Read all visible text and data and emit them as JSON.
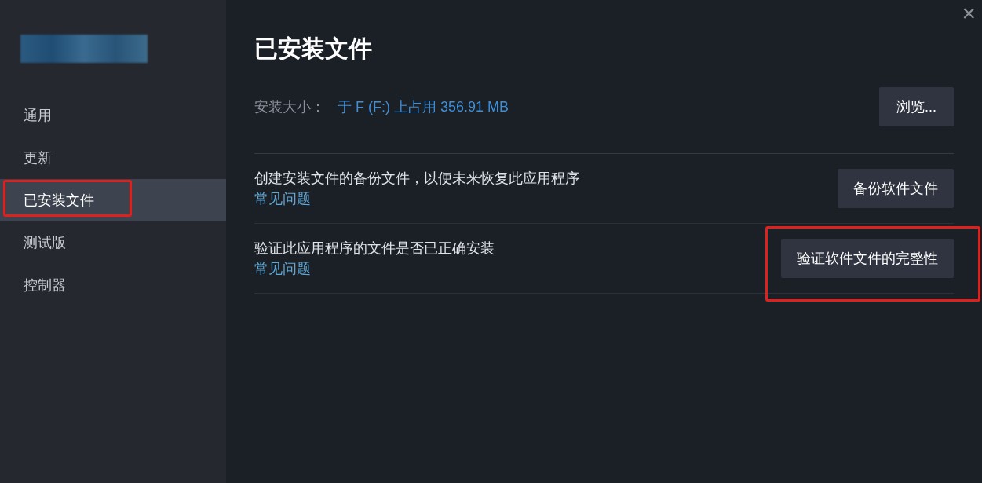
{
  "sidebar": {
    "items": [
      {
        "label": "通用",
        "selected": false,
        "highlighted": false
      },
      {
        "label": "更新",
        "selected": false,
        "highlighted": false
      },
      {
        "label": "已安装文件",
        "selected": true,
        "highlighted": true
      },
      {
        "label": "测试版",
        "selected": false,
        "highlighted": false
      },
      {
        "label": "控制器",
        "selected": false,
        "highlighted": false
      }
    ]
  },
  "close_button": "×",
  "title": "已安装文件",
  "install_size": {
    "label": "安装大小：",
    "value": "于 F (F:) 上占用 356.91 MB",
    "button": "浏览..."
  },
  "sections": [
    {
      "description": "创建安装文件的备份文件，以便未来恢复此应用程序",
      "link": "常见问题",
      "button": "备份软件文件",
      "highlighted": false
    },
    {
      "description": "验证此应用程序的文件是否已正确安装",
      "link": "常见问题",
      "button": "验证软件文件的完整性",
      "highlighted": true
    }
  ]
}
